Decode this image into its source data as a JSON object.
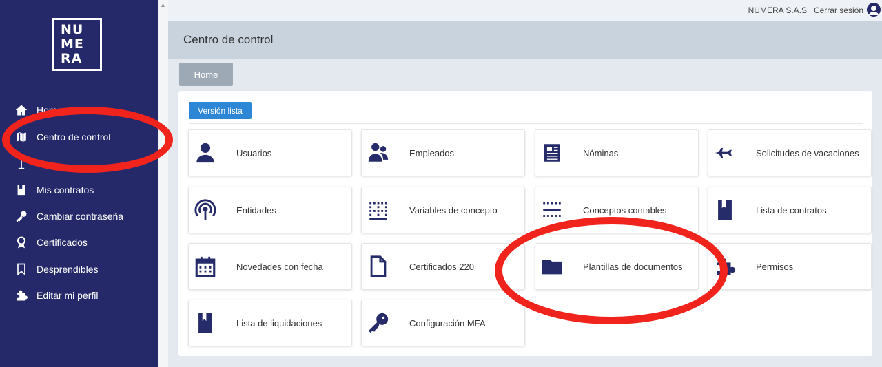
{
  "brand": {
    "logo_lines": [
      "NU",
      "ME",
      "RA"
    ]
  },
  "sidebar": {
    "items": [
      {
        "label": "Home",
        "icon": "home-icon"
      },
      {
        "label": "Centro de control",
        "icon": "map-icon"
      },
      {
        "label": "",
        "icon": "pin-icon"
      },
      {
        "label": "Mis contratos",
        "icon": "book-icon"
      },
      {
        "label": "Cambiar contraseña",
        "icon": "key-icon"
      },
      {
        "label": "Certificados",
        "icon": "certificate-icon"
      },
      {
        "label": "Desprendibles",
        "icon": "bookmark-icon"
      },
      {
        "label": "Editar mi perfil",
        "icon": "puzzle-icon"
      }
    ]
  },
  "topbar": {
    "company": "NUMERA S.A.S",
    "logout": "Cerrar sesión"
  },
  "header": {
    "title": "Centro de control"
  },
  "breadcrumb": {
    "home": "Home"
  },
  "panel": {
    "list_button": "Versión lista",
    "cards": [
      {
        "label": "Usuarios",
        "icon": "user-icon"
      },
      {
        "label": "Empleados",
        "icon": "users-icon"
      },
      {
        "label": "Nóminas",
        "icon": "newspaper-icon"
      },
      {
        "label": "Solicitudes de vacaciones",
        "icon": "airplane-icon"
      },
      {
        "label": "Entidades",
        "icon": "broadcast-icon"
      },
      {
        "label": "Variables de concepto",
        "icon": "grid-dots-icon"
      },
      {
        "label": "Conceptos contables",
        "icon": "grid-lines-icon"
      },
      {
        "label": "Lista de contratos",
        "icon": "book-icon"
      },
      {
        "label": "Novedades con fecha",
        "icon": "calendar-icon"
      },
      {
        "label": "Certificados 220",
        "icon": "file-icon"
      },
      {
        "label": "Plantillas de documentos",
        "icon": "folder-icon"
      },
      {
        "label": "Permisos",
        "icon": "puzzle-icon"
      },
      {
        "label": "Lista de liquidaciones",
        "icon": "book-icon"
      },
      {
        "label": "Configuración MFA",
        "icon": "key-icon"
      }
    ]
  },
  "annotations": {
    "color": "#f0241d"
  }
}
